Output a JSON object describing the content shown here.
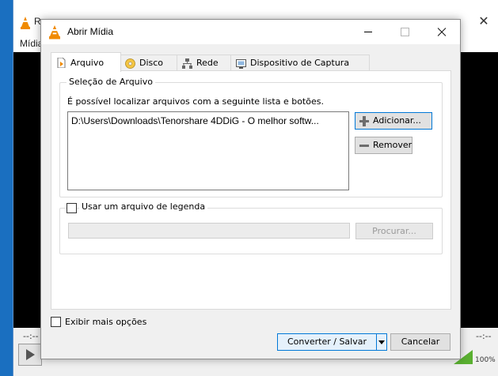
{
  "background_window": {
    "title": "R",
    "menu_text": "Mídia",
    "time_left": "--:--",
    "time_right": "--:--",
    "volume": "100%"
  },
  "dialog": {
    "title": "Abrir Mídia",
    "tabs": [
      {
        "label": "Arquivo",
        "icon": "file-play-icon",
        "active": true
      },
      {
        "label": "Disco",
        "icon": "disc-icon",
        "active": false
      },
      {
        "label": "Rede",
        "icon": "network-icon",
        "active": false
      },
      {
        "label": "Dispositivo de Captura",
        "icon": "capture-device-icon",
        "active": false
      }
    ],
    "file_selection": {
      "legend": "Seleção de Arquivo",
      "hint": "É possível localizar arquivos com a seguinte lista e botões.",
      "files": [
        "D:\\Users\\Downloads\\Tenorshare 4DDiG - O melhor softw..."
      ],
      "add_label": "Adicionar...",
      "remove_label": "Remover"
    },
    "subtitle": {
      "label": "Usar um arquivo de legenda",
      "checked": false,
      "field_value": "",
      "browse_label": "Procurar..."
    },
    "show_more": {
      "label": "Exibir mais opções",
      "checked": false
    },
    "convert_label": "Converter / Salvar",
    "cancel_label": "Cancelar"
  },
  "colors": {
    "accent": "#0078d7",
    "vlc_orange": "#f08a00",
    "desktop_blue": "#1a6fc0"
  }
}
